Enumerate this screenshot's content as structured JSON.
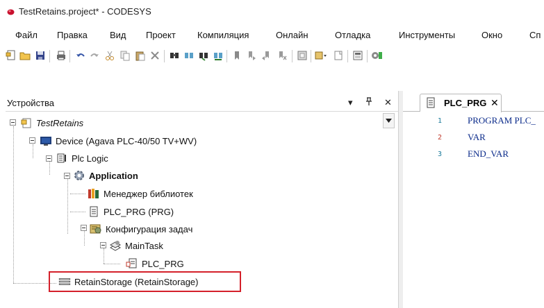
{
  "window": {
    "title": "TestRetains.project* - CODESYS"
  },
  "menu": [
    "Файл",
    "Правка",
    "Вид",
    "Проект",
    "Компиляция",
    "Онлайн",
    "Отладка",
    "Инструменты",
    "Окно",
    "Сп"
  ],
  "toolbar": {
    "icons": [
      "new-project-icon",
      "open-folder-icon",
      "save-icon",
      "print-icon",
      "undo-icon",
      "redo-icon",
      "cut-icon",
      "copy-icon",
      "paste-icon",
      "delete-icon",
      "find-icon",
      "find-next-icon",
      "find-previous-icon",
      "replace-icon",
      "bookmark-icon",
      "bookmark-next-icon",
      "bookmark-prev-icon",
      "bookmark-clear-icon",
      "insert-object-icon",
      "add-object-icon",
      "properties-icon",
      "build-icon",
      "login-icon"
    ]
  },
  "devices": {
    "title": "Устройства",
    "nodes": [
      {
        "label": "TestRetains",
        "icon": "project-icon",
        "italic": true
      },
      {
        "label": "Device (Agava PLC-40/50 TV+WV)",
        "icon": "device-icon"
      },
      {
        "label": "Plc Logic",
        "icon": "plc-logic-icon"
      },
      {
        "label": "Application",
        "icon": "application-gear-icon",
        "bold": true
      },
      {
        "label": "Менеджер библиотек",
        "icon": "library-manager-icon"
      },
      {
        "label": "PLC_PRG (PRG)",
        "icon": "pou-icon"
      },
      {
        "label": "Конфигурация задач",
        "icon": "task-config-icon"
      },
      {
        "label": "MainTask",
        "icon": "task-icon"
      },
      {
        "label": "PLC_PRG",
        "icon": "program-call-icon"
      },
      {
        "label": "RetainStorage (RetainStorage)",
        "icon": "retain-storage-icon"
      }
    ]
  },
  "editor": {
    "tab_label": "PLC_PRG",
    "lines": [
      {
        "n": "1",
        "text": "PROGRAM PLC_"
      },
      {
        "n": "2",
        "text": "VAR"
      },
      {
        "n": "3",
        "text": "END_VAR"
      }
    ]
  },
  "colors": {
    "highlight": "#d4202a",
    "code": "#0a2a8a",
    "line_number": "#1a7a9a",
    "accent_red": "#c8102e"
  }
}
